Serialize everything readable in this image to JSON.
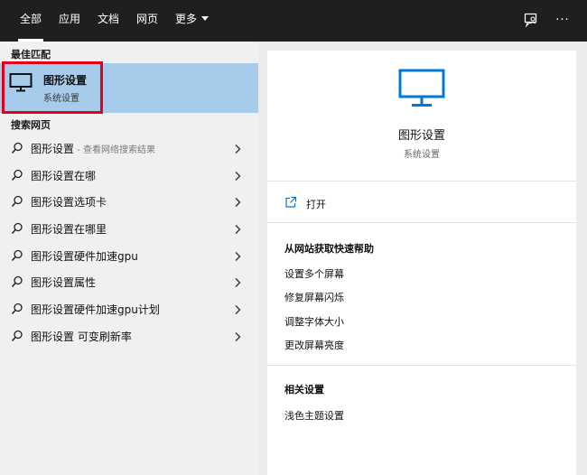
{
  "topbar": {
    "tabs": [
      {
        "label": "全部",
        "active": true
      },
      {
        "label": "应用",
        "active": false
      },
      {
        "label": "文档",
        "active": false
      },
      {
        "label": "网页",
        "active": false
      },
      {
        "label": "更多",
        "active": false,
        "has_dropdown": true
      }
    ],
    "icons": [
      "feedback-icon",
      "more-options-icon"
    ],
    "more_options_glyph": "···"
  },
  "left": {
    "best_match_heading": "最佳匹配",
    "best_match": {
      "title": "图形设置",
      "subtitle": "系统设置",
      "icon": "monitor-icon",
      "highlighted": true
    },
    "web_heading": "搜索网页",
    "web_results": [
      {
        "text": "图形设置",
        "hint": " - 查看网络搜索结果"
      },
      {
        "text": "图形设置在哪",
        "hint": ""
      },
      {
        "text": "图形设置选项卡",
        "hint": ""
      },
      {
        "text": "图形设置在哪里",
        "hint": ""
      },
      {
        "text": "图形设置硬件加速gpu",
        "hint": ""
      },
      {
        "text": "图形设置属性",
        "hint": ""
      },
      {
        "text": "图形设置硬件加速gpu计划",
        "hint": ""
      },
      {
        "text": "图形设置 可变刷新率",
        "hint": ""
      }
    ]
  },
  "right": {
    "title": "图形设置",
    "subtitle": "系统设置",
    "open_label": "打开",
    "help_heading": "从网站获取快速帮助",
    "help_links": [
      "设置多个屏幕",
      "修复屏幕闪烁",
      "调整字体大小",
      "更改屏幕亮度"
    ],
    "related_heading": "相关设置",
    "related_links": [
      "浅色主题设置"
    ]
  },
  "colors": {
    "topbar_bg": "#1f1f1f",
    "selected_bg": "#a7cbea",
    "highlight_border": "#e0001b",
    "accent_blue": "#0078d7"
  }
}
